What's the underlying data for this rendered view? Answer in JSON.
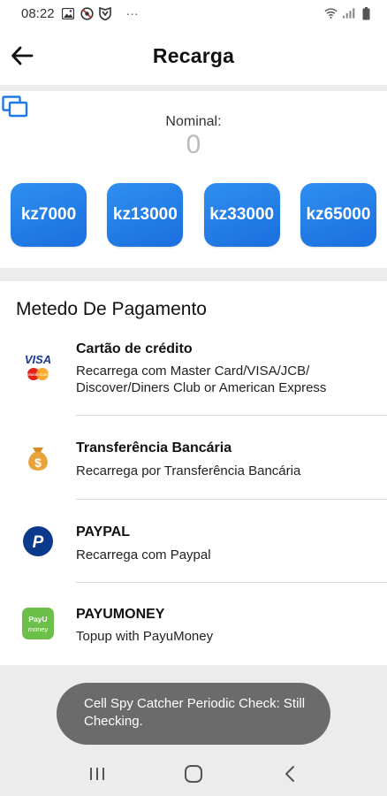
{
  "status_bar": {
    "time": "08:22",
    "more": "···",
    "icons_left": [
      "image-icon",
      "blocked-icon",
      "shield-icon"
    ],
    "icons_right": [
      "wifi-icon",
      "signal-icon",
      "battery-icon"
    ]
  },
  "header": {
    "title": "Recarga",
    "back_icon": "arrow-left-icon"
  },
  "nominal": {
    "label": "Nominal:",
    "value": "0",
    "amounts": [
      "kz7000",
      "kz13000",
      "kz33000",
      "kz65000"
    ],
    "accent_color": "#1f78e6"
  },
  "payment": {
    "section_title": "Metedo De Pagamento",
    "methods": [
      {
        "title": "Cartão de crédito",
        "description": "Recarrega com Master Card/VISA/JCB/ Discover/Diners Club or American Express",
        "icon": "visa-mastercard-icon",
        "icon_text_top": "VISA",
        "icon_text_bottom": "MasterCard"
      },
      {
        "title": "Transferência Bancária",
        "description": "Recarrega por Transferência Bancária",
        "icon": "money-bag-icon",
        "icon_text": "$"
      },
      {
        "title": "PAYPAL",
        "description": "Recarrega com Paypal",
        "icon": "paypal-icon",
        "icon_text": "P"
      },
      {
        "title": "PAYUMONEY",
        "description": "Topup with PayuMoney",
        "icon": "payumoney-icon",
        "icon_text": "PayU money"
      }
    ]
  },
  "toast": {
    "text": "Cell Spy Catcher Periodic Check: Still Checking."
  },
  "nav": {
    "buttons": [
      "recents-icon",
      "home-icon",
      "back-icon"
    ]
  }
}
